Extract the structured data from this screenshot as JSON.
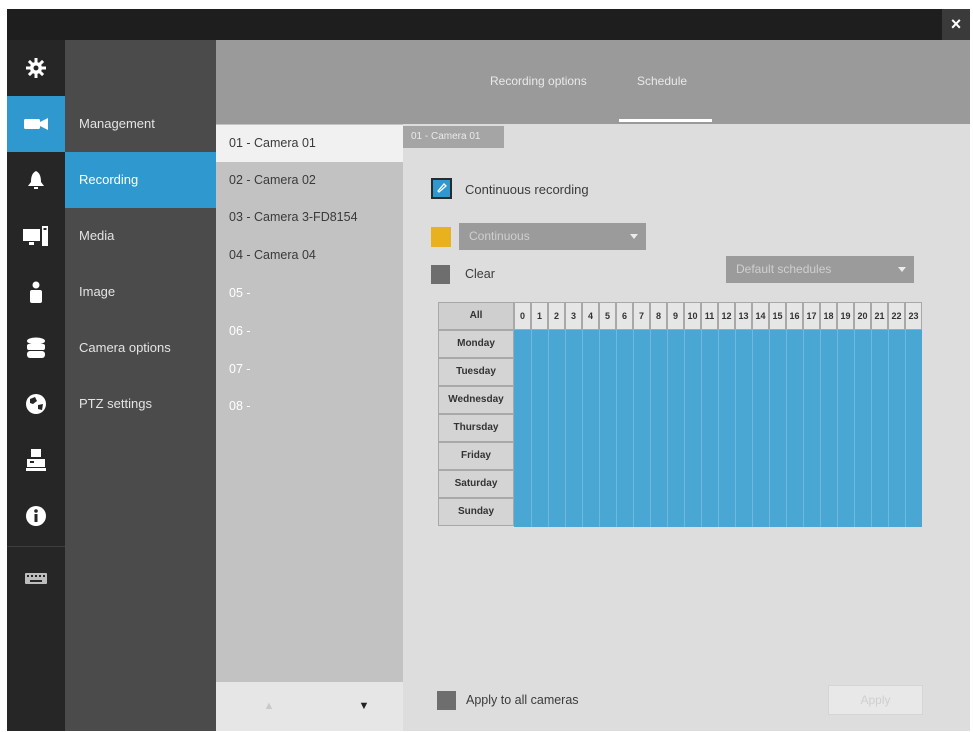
{
  "window": {
    "close_label": "×"
  },
  "sidebar_icons": [
    {
      "name": "gear-icon"
    },
    {
      "name": "camera-icon"
    },
    {
      "name": "alarm-icon"
    },
    {
      "name": "monitor-icon"
    },
    {
      "name": "user-icon"
    },
    {
      "name": "storage-icon"
    },
    {
      "name": "network-icon"
    },
    {
      "name": "system-icon"
    },
    {
      "name": "info-icon"
    },
    {
      "name": "keyboard-icon"
    }
  ],
  "submenu": {
    "items": [
      {
        "label": "Management"
      },
      {
        "label": "Recording"
      },
      {
        "label": "Media"
      },
      {
        "label": "Image"
      },
      {
        "label": "Camera options"
      },
      {
        "label": "PTZ settings"
      }
    ],
    "active": "Recording"
  },
  "tabs": [
    {
      "label": "Recording options"
    },
    {
      "label": "Schedule"
    }
  ],
  "cameras": [
    {
      "label": "01 - Camera 01"
    },
    {
      "label": "02 - Camera 02"
    },
    {
      "label": "03 - Camera 3-FD8154"
    },
    {
      "label": "04 - Camera 04"
    },
    {
      "label": "05 -"
    },
    {
      "label": "06 -"
    },
    {
      "label": "07 -"
    },
    {
      "label": "08 -"
    }
  ],
  "selected_camera_tag": "01 - Camera 01",
  "schedule": {
    "continuous_label": "Continuous recording",
    "mode_dropdown_value": "Continuous",
    "clear_label": "Clear",
    "default_schedules_label": "Default schedules",
    "all_label": "All",
    "hours": [
      "0",
      "1",
      "2",
      "3",
      "4",
      "5",
      "6",
      "7",
      "8",
      "9",
      "10",
      "11",
      "12",
      "13",
      "14",
      "15",
      "16",
      "17",
      "18",
      "19",
      "20",
      "21",
      "22",
      "23"
    ],
    "days": [
      "Monday",
      "Tuesday",
      "Wednesday",
      "Thursday",
      "Friday",
      "Saturday",
      "Sunday"
    ],
    "apply_all_label": "Apply to all cameras",
    "apply_button_label": "Apply"
  },
  "colors": {
    "accent": "#2f98cf",
    "schedule_fill": "#4aa7d3",
    "yellow": "#e8b21e"
  }
}
